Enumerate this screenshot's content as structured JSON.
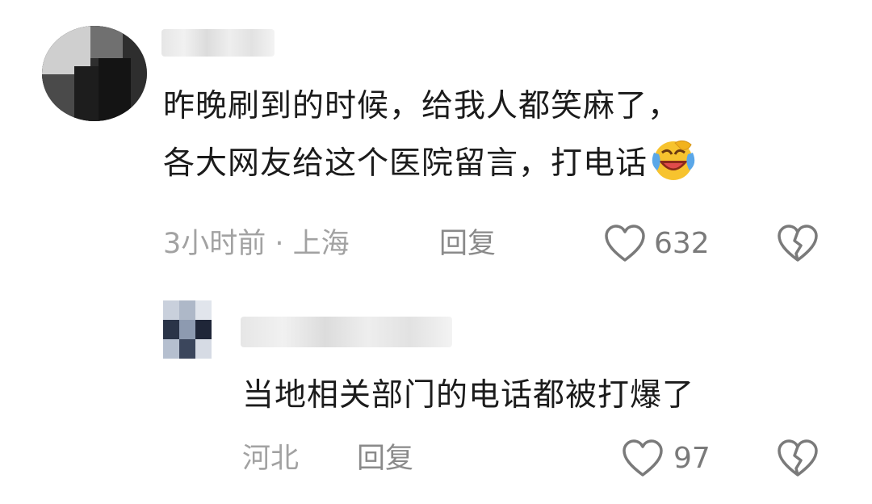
{
  "comments": [
    {
      "text_line1": "昨晚刷到的时候，给我人都笑麻了，",
      "text_line2": "各大网友给这个医院留言，打电话",
      "emoji": "laughing-crying-face",
      "time": "3小时前",
      "separator": "·",
      "location": "上海",
      "reply_label": "回复",
      "likes": "632"
    },
    {
      "text": "当地相关部门的电话都被打爆了",
      "location": "河北",
      "reply_label": "回复",
      "likes": "97"
    }
  ],
  "colors": {
    "text": "#1b1b1b",
    "meta": "#a2a2a2",
    "icon": "#7a7a7a"
  },
  "icons": {
    "like": "heart-outline-icon",
    "dislike": "broken-heart-icon"
  }
}
